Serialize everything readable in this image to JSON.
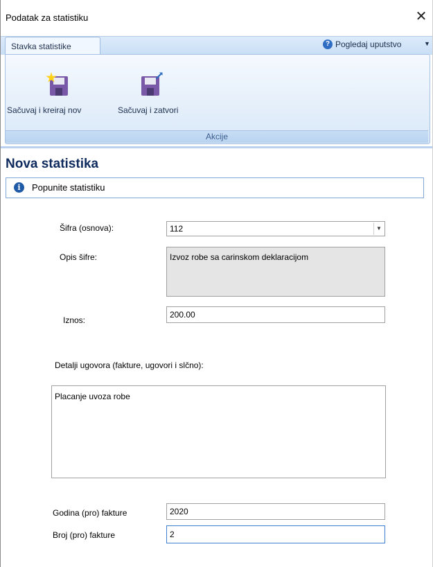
{
  "window": {
    "title": "Podatak za statistiku",
    "close_glyph": "✕"
  },
  "ribbon": {
    "tab_label": "Stavka statistike",
    "help_label": "Pogledaj uputstvo",
    "help_icon": "help-circle-icon",
    "buttons": [
      {
        "label": "Sačuvaj i kreiraj nov",
        "icon": "save-new-icon"
      },
      {
        "label": "Sačuvaj i zatvori",
        "icon": "save-close-icon"
      }
    ],
    "group_label": "Akcije"
  },
  "header": {
    "title": "Nova statistika",
    "info_text": "Popunite statistiku",
    "info_icon": "info-icon"
  },
  "form": {
    "sifra": {
      "label": "Šifra (osnova):",
      "value": "112"
    },
    "opis": {
      "label": "Opis šifre:",
      "value": "Izvoz robe sa carinskom deklaracijom"
    },
    "iznos": {
      "label": "Iznos:",
      "value": "200.00"
    },
    "detalji": {
      "label": "Detalji ugovora (fakture, ugovori i slčno):",
      "value": "Placanje uvoza robe"
    },
    "godina": {
      "label": "Godina (pro) fakture",
      "value": "2020"
    },
    "broj": {
      "label": "Broj (pro) fakture",
      "value": "2"
    }
  },
  "colors": {
    "accent": "#0f2b5e",
    "ribbon": "#d9e8f8",
    "focus_border": "#3c7fd0"
  }
}
